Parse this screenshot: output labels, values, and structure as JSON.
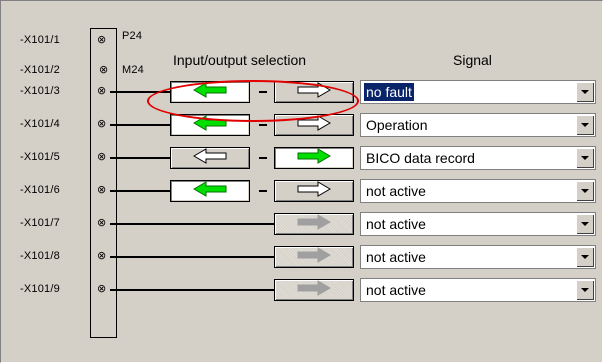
{
  "panel": {
    "header_io": "Input/output selection",
    "header_signal": "Signal",
    "supply": [
      {
        "terminal": "-X101/1",
        "pin_label": "P24"
      },
      {
        "terminal": "-X101/2",
        "pin_label": "M24"
      }
    ],
    "rows": [
      {
        "terminal": "-X101/3",
        "input_active": true,
        "output_active": false,
        "output_disabled": false,
        "signal": "no fault",
        "selected": true
      },
      {
        "terminal": "-X101/4",
        "input_active": true,
        "output_active": false,
        "output_disabled": false,
        "signal": "Operation",
        "selected": false
      },
      {
        "terminal": "-X101/5",
        "input_active": false,
        "output_active": true,
        "output_disabled": false,
        "signal": "BICO data record",
        "selected": false
      },
      {
        "terminal": "-X101/6",
        "input_active": true,
        "output_active": false,
        "output_disabled": false,
        "signal": "not active",
        "selected": false
      },
      {
        "terminal": "-X101/7",
        "input_active": null,
        "output_active": false,
        "output_disabled": true,
        "signal": "not active",
        "selected": false
      },
      {
        "terminal": "-X101/8",
        "input_active": null,
        "output_active": false,
        "output_disabled": true,
        "signal": "not active",
        "selected": false
      },
      {
        "terminal": "-X101/9",
        "input_active": null,
        "output_active": false,
        "output_disabled": true,
        "signal": "not active",
        "selected": false
      }
    ]
  },
  "colors": {
    "active_arrow": "#00e000",
    "inactive_arrow": "#ffffff",
    "disabled_arrow": "#a0a0a0",
    "highlight": "#0a246a",
    "annotation": "#e00000"
  }
}
